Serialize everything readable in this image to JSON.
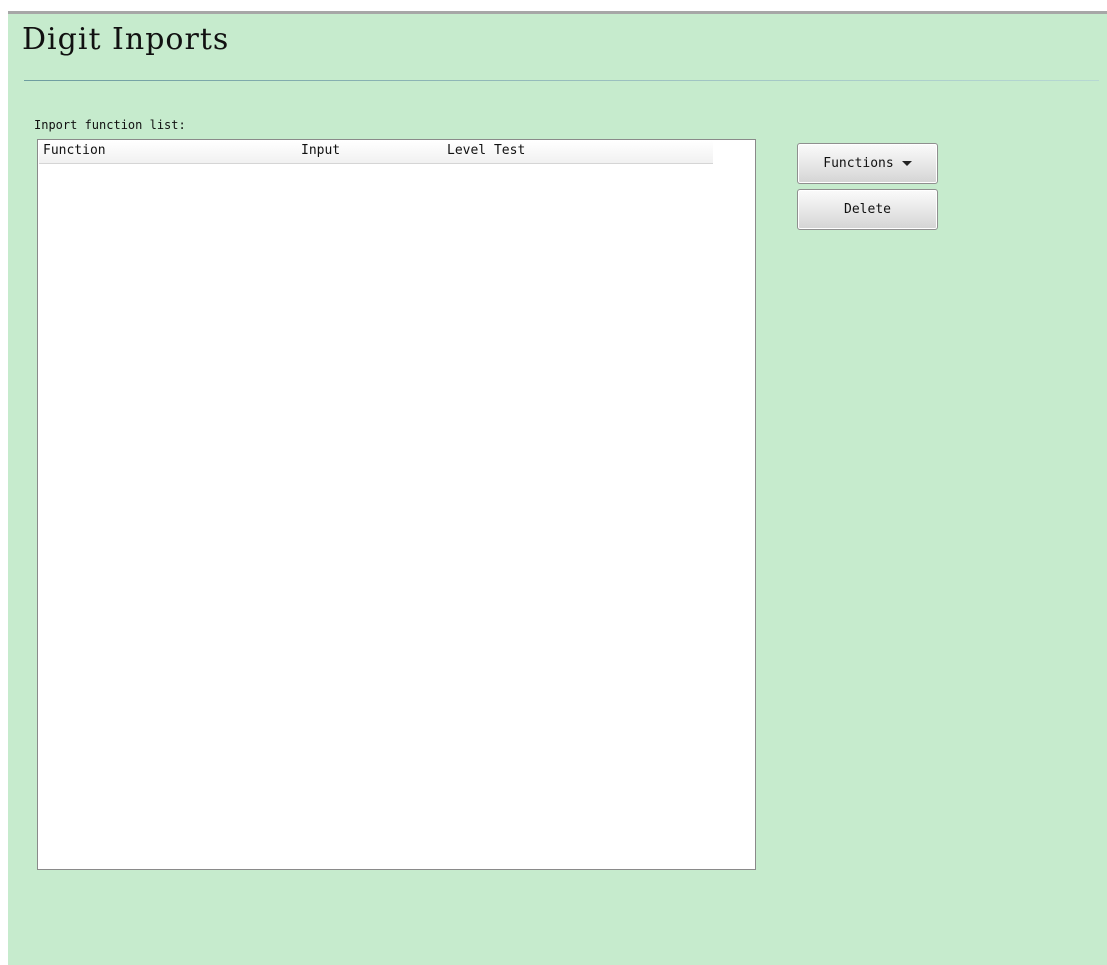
{
  "page": {
    "title": "Digit Inports"
  },
  "list": {
    "label": "Inport function list:",
    "columns": [
      {
        "label": "Function"
      },
      {
        "label": "Input"
      },
      {
        "label": "Level Test"
      }
    ],
    "rows": []
  },
  "actions": {
    "functions_label": "Functions",
    "functions_icon": "chevron-down-icon",
    "delete_label": "Delete"
  },
  "colors": {
    "panel_background": "#c6ebcd",
    "list_background": "#ffffff"
  }
}
